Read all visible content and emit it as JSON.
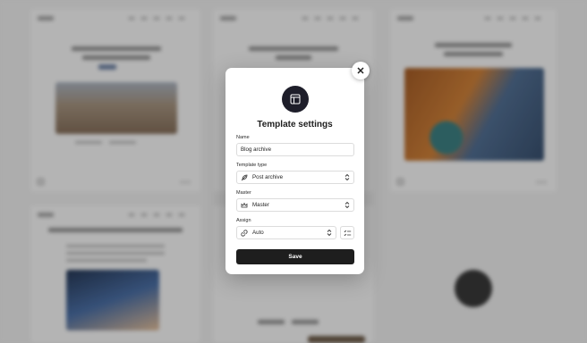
{
  "modal": {
    "title": "Template settings",
    "close_icon": "close-icon",
    "header_icon": "layout-template-icon",
    "name": {
      "label": "Name",
      "value": "Blog archive"
    },
    "template_type": {
      "label": "Template type",
      "value": "Post archive",
      "icon": "feather-icon"
    },
    "master": {
      "label": "Master",
      "value": "Master",
      "icon": "crown-icon"
    },
    "assign": {
      "label": "Assign",
      "value": "Auto",
      "icon": "link-icon",
      "options_icon": "list-check-icon"
    },
    "save_label": "Save"
  },
  "colors": {
    "modal_bg": "#ffffff",
    "save_button": "#1e1e1e",
    "header_icon_bg": "#1e1e2a",
    "backdrop": "#c9c9c9"
  }
}
